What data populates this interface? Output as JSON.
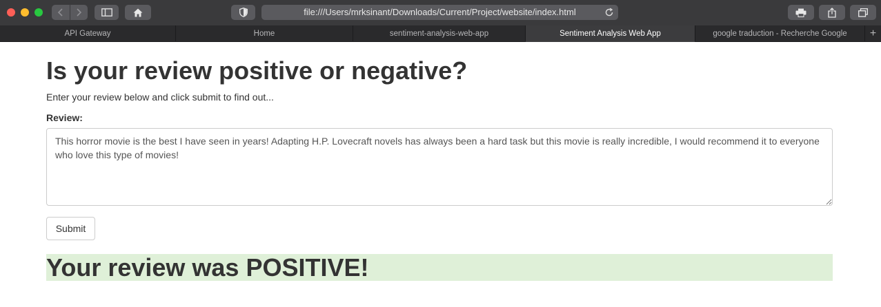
{
  "browser": {
    "url": "file:///Users/mrksinant/Downloads/Current/Project/website/index.html",
    "tabs": [
      {
        "label": "API Gateway",
        "active": false
      },
      {
        "label": "Home",
        "active": false
      },
      {
        "label": "sentiment-analysis-web-app",
        "active": false
      },
      {
        "label": "Sentiment Analysis Web App",
        "active": true
      },
      {
        "label": "google traduction - Recherche Google",
        "active": false
      }
    ],
    "new_tab_label": "+",
    "icons": [
      "back-icon",
      "forward-icon",
      "sidebar-icon",
      "home-icon",
      "shield-icon",
      "reload-icon",
      "print-icon",
      "share-icon",
      "tabs-overview-icon"
    ]
  },
  "page": {
    "title": "Is your review positive or negative?",
    "intro": "Enter your review below and click submit to find out...",
    "review_label": "Review:",
    "review_text": "This horror movie is the best I have seen in years! Adapting H.P. Lovecraft novels has always been a hard task but this movie is really incredible, I would recommend it to everyone who love this type of movies!",
    "submit_label": "Submit",
    "result": "Your review was POSITIVE!",
    "result_color": "#dff0d8"
  }
}
